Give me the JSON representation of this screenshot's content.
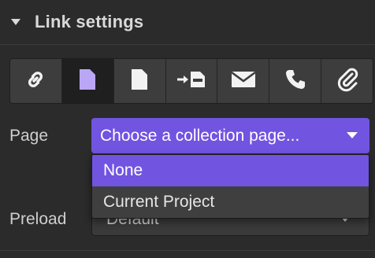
{
  "header": {
    "title": "Link settings"
  },
  "link_types": [
    {
      "icon": "link-icon",
      "active": false
    },
    {
      "icon": "page-icon",
      "active": true
    },
    {
      "icon": "collection-page-icon",
      "active": false
    },
    {
      "icon": "page-section-icon",
      "active": false
    },
    {
      "icon": "email-icon",
      "active": false
    },
    {
      "icon": "phone-icon",
      "active": false
    },
    {
      "icon": "attachment-icon",
      "active": false
    }
  ],
  "page_field": {
    "label": "Page",
    "value": "Choose a collection page...",
    "options": [
      "None",
      "Current Project"
    ],
    "highlighted_option": "None"
  },
  "preload_field": {
    "label": "Preload",
    "value": "Default"
  },
  "colors": {
    "accent": "#7154e0",
    "active_icon": "#b9a7f5",
    "panel_bg": "#2b2b2b"
  }
}
